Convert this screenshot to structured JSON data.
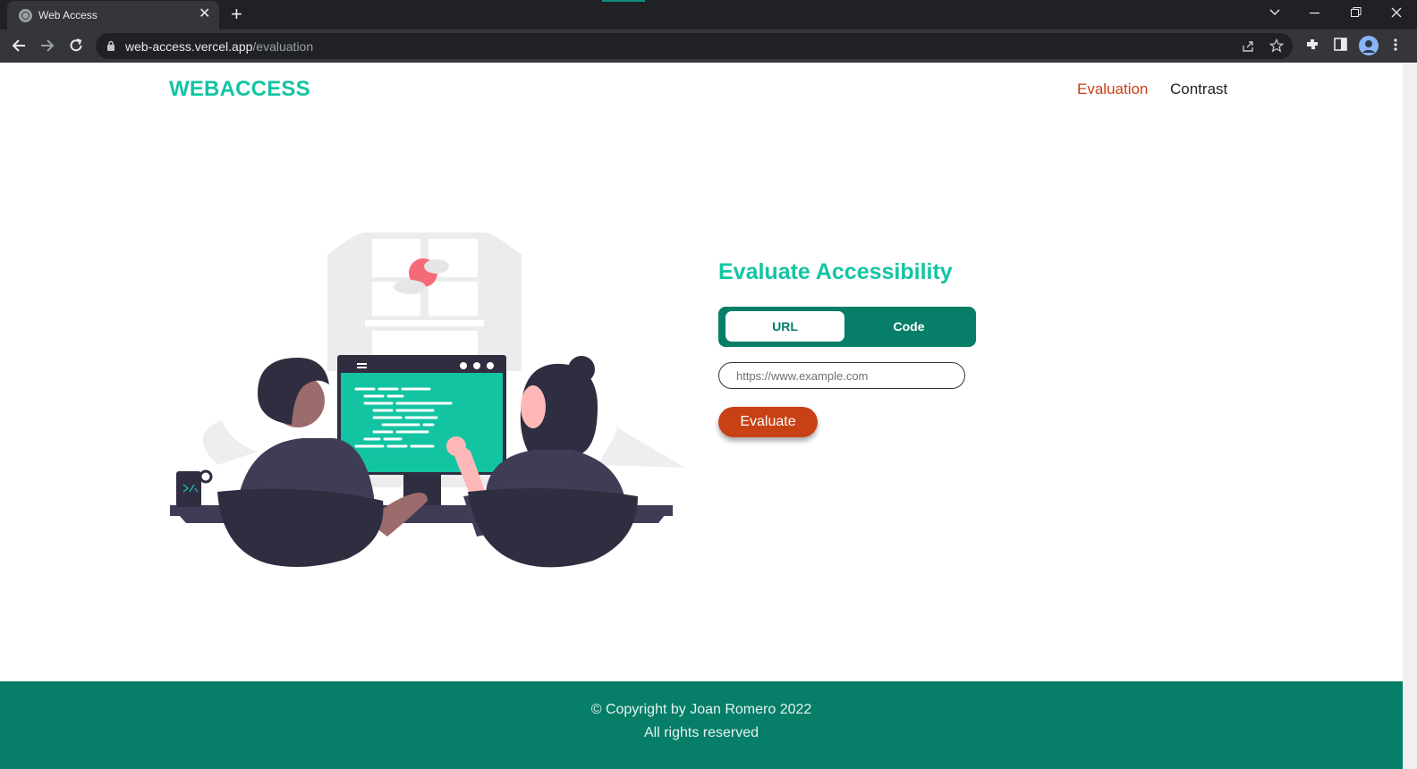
{
  "browser": {
    "tab_title": "Web Access",
    "tab_close": "✕",
    "new_tab": "+",
    "url_host": "web-access.vercel.app",
    "url_path": "/evaluation"
  },
  "site": {
    "logo": "WEBACCESS",
    "nav": {
      "evaluation": "Evaluation",
      "contrast": "Contrast"
    }
  },
  "form": {
    "title": "Evaluate Accessibility",
    "tabs": {
      "url": "URL",
      "code": "Code"
    },
    "input_placeholder": "https://www.example.com",
    "input_value": "",
    "submit": "Evaluate"
  },
  "footer": {
    "copyright": "© Copyright by Joan Romero 2022",
    "rights": "All rights reserved"
  },
  "colors": {
    "brand_teal": "#13c4a3",
    "dark_teal": "#067e68",
    "accent_orange": "#c84114"
  }
}
